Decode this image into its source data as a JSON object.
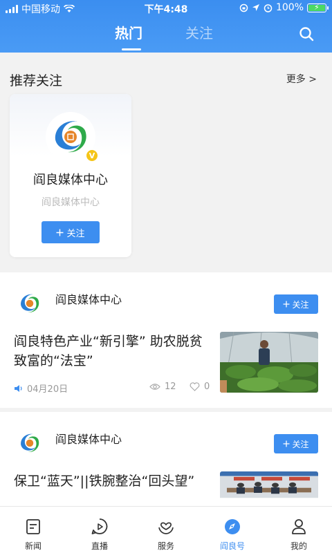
{
  "status_bar": {
    "carrier": "中国移动",
    "time": "下午4:48",
    "battery": "100%"
  },
  "top_tabs": {
    "hot": "热门",
    "follow": "关注"
  },
  "recommended": {
    "title": "推荐关注",
    "more": "更多 >",
    "card": {
      "name": "阎良媒体中心",
      "subtitle": "阎良媒体中心",
      "follow_label": "关注"
    }
  },
  "feed": [
    {
      "author": "阎良媒体中心",
      "follow_label": "关注",
      "title": "阎良特色产业“新引擎” 助农脱贫致富的“法宝”",
      "date": "04月20日",
      "views": "12",
      "likes": "0"
    },
    {
      "author": "阎良媒体中心",
      "follow_label": "关注",
      "title": "保卫“蓝天”||铁腕整治“回头望”"
    }
  ],
  "bottom_nav": {
    "items": [
      {
        "label": "新闻",
        "icon": "news-icon"
      },
      {
        "label": "直播",
        "icon": "live-icon"
      },
      {
        "label": "服务",
        "icon": "service-icon"
      },
      {
        "label": "阎良号",
        "icon": "compass-icon"
      },
      {
        "label": "我的",
        "icon": "profile-icon"
      }
    ],
    "active": "阎良号"
  },
  "colors": {
    "accent": "#3d8ef0",
    "header": "#4a9bf5"
  }
}
